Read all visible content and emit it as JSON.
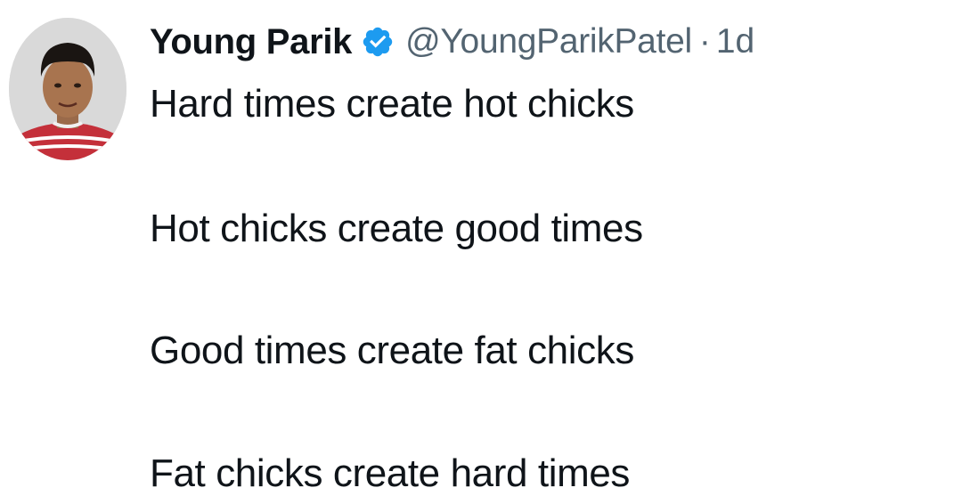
{
  "tweet": {
    "author": {
      "display_name": "Young Parik",
      "handle": "@YoungParikPatel",
      "separator": "·",
      "time": "1d",
      "verified_icon": "verified-badge-icon",
      "avatar_icon": "avatar"
    },
    "lines": [
      "Hard times create hot chicks",
      "Hot chicks create good times",
      "Good times create fat chicks",
      "Fat chicks create hard times"
    ]
  },
  "colors": {
    "text": "#0f1419",
    "secondary": "#536471",
    "verified": "#1d9bf0",
    "background": "#ffffff"
  }
}
